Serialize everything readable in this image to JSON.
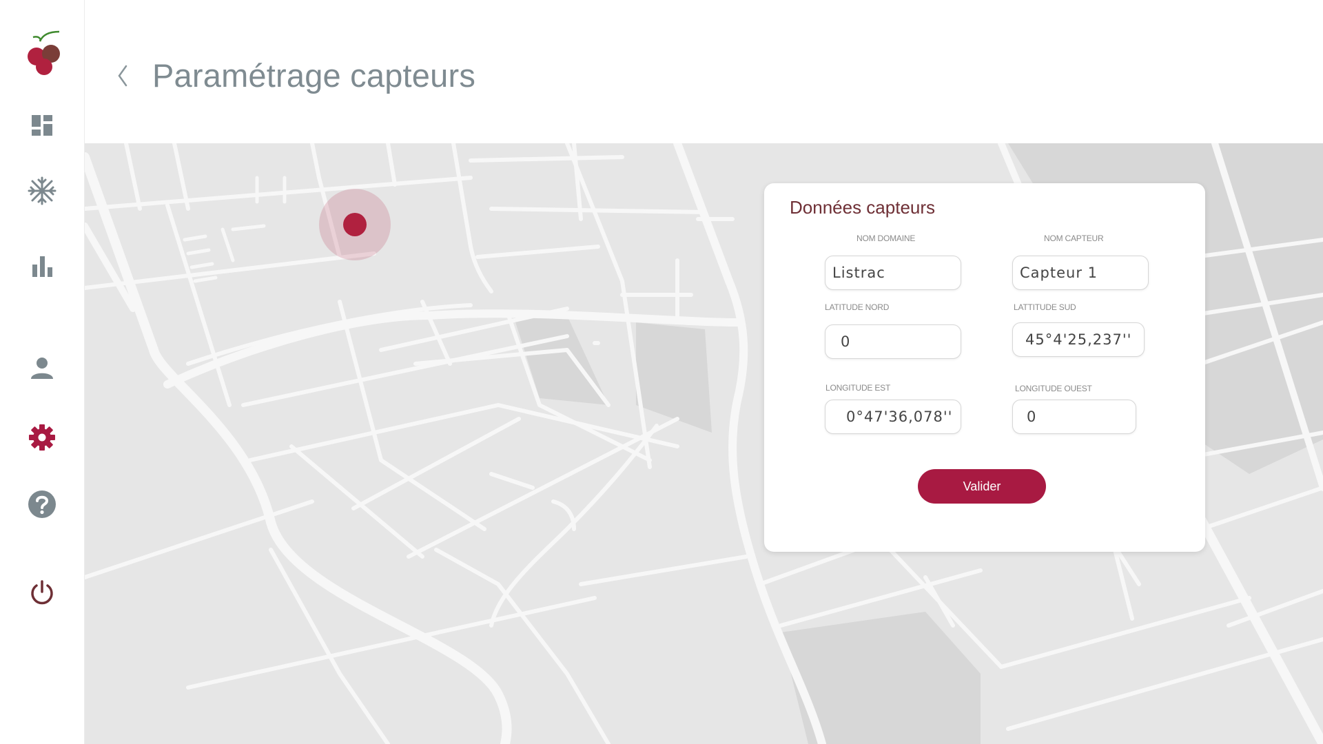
{
  "header": {
    "title": "Paramétrage capteurs",
    "back_icon": "chevron-left-icon"
  },
  "sidebar": {
    "items": [
      {
        "name": "dashboard",
        "icon": "dashboard-icon"
      },
      {
        "name": "frost",
        "icon": "snowflake-icon"
      },
      {
        "name": "stats",
        "icon": "bar-chart-icon"
      },
      {
        "name": "account",
        "icon": "user-icon"
      },
      {
        "name": "settings",
        "icon": "gear-icon",
        "active": true
      },
      {
        "name": "help",
        "icon": "help-icon"
      },
      {
        "name": "logout",
        "icon": "power-icon"
      }
    ]
  },
  "card": {
    "title": "Données capteurs",
    "fields": {
      "domain": {
        "label": "NOM DOMAINE",
        "value": "Listrac"
      },
      "sensor": {
        "label": "NOM CAPTEUR",
        "value": "Capteur 1"
      },
      "lat_north": {
        "label": "LATITUDE NORD",
        "value": "0"
      },
      "lat_south": {
        "label": "LATTITUDE SUD",
        "value": "45°4'25,237''"
      },
      "lon_east": {
        "label": "LONGITUDE EST",
        "value": "0°47'36,078''"
      },
      "lon_west": {
        "label": "LONGITUDE OUEST",
        "value": "0"
      }
    },
    "submit_label": "Valider"
  },
  "colors": {
    "accent": "#a81a42",
    "title_gray": "#7f8b91",
    "icon_gray": "#7c888e",
    "card_title": "#6e2f35",
    "map_bg": "#e6e6e6",
    "road": "#f7f7f7"
  }
}
